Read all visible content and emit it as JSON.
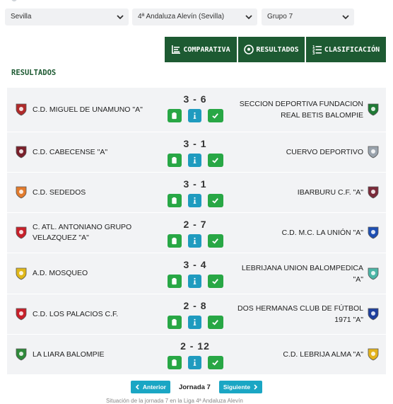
{
  "filters": [
    {
      "value": "Sevilla"
    },
    {
      "value": "4ª Andaluza Alevín (Sevilla)"
    },
    {
      "value": "Grupo 7"
    }
  ],
  "tabs": [
    {
      "label": "COMPARATIVA",
      "icon": "list-align-icon"
    },
    {
      "label": "RESULTADOS",
      "icon": "soccer-ball-icon"
    },
    {
      "label": "CLASIFICACIÓN",
      "icon": "ranking-list-icon"
    }
  ],
  "section_title": "RESULTADOS",
  "matches": [
    {
      "home": "C.D. MIGUEL DE UNAMUNO \"A\"",
      "score": "3 - 6",
      "away": "SECCION DEPORTIVA FUNDACION REAL BETIS BALOMPIE",
      "home_color": "#b02a2a",
      "away_color": "#1f7a35"
    },
    {
      "home": "C.D. CABECENSE \"A\"",
      "score": "3 - 1",
      "away": "CUERVO DEPORTIVO",
      "home_color": "#7a1f2a",
      "away_color": "#9aa3ad"
    },
    {
      "home": "C.D. SEDEDOS",
      "score": "3 - 1",
      "away": "IBARBURU C.F. \"A\"",
      "home_color": "#e27b2d",
      "away_color": "#7a2a3a"
    },
    {
      "home": "C. ATL. ANTONIANO GRUPO VELAZQUEZ \"A\"",
      "score": "2 - 7",
      "away": "C.D. M.C. LA UNIÓN \"A\"",
      "home_color": "#c8202a",
      "away_color": "#1e4fb3"
    },
    {
      "home": "A.D. MOSQUEO",
      "score": "3 - 4",
      "away": "LEBRIJANA UNION BALOMPEDICA \"A\"",
      "home_color": "#e0b81a",
      "away_color": "#4bb5a6"
    },
    {
      "home": "C.D. LOS PALACIOS C.F.",
      "score": "2 - 8",
      "away": "DOS HERMANAS CLUB DE FÚTBOL 1971 \"A\"",
      "home_color": "#c8202a",
      "away_color": "#1e3f9e"
    },
    {
      "home": "LA LIARA BALOMPIE",
      "score": "2 - 12",
      "away": "C.D. LEBRIJA ALMA \"A\"",
      "home_color": "#2f8a3a",
      "away_color": "#e3b21c"
    }
  ],
  "pager": {
    "prev": "Anterior",
    "current": "Jornada 7",
    "next": "Siguiente"
  },
  "footer_text": "Situación de la jornada 7 en la Liga 4ª Andaluza Alevín"
}
